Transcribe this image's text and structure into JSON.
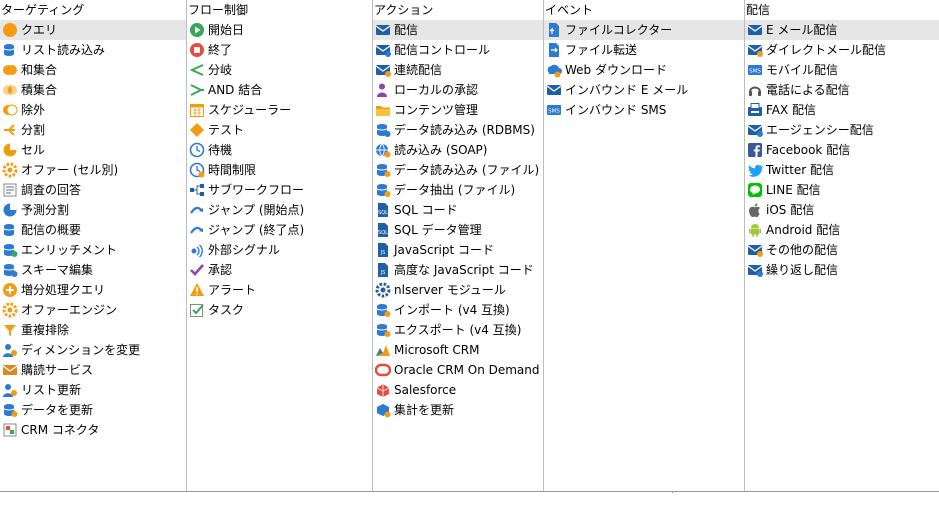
{
  "columns": [
    {
      "header": "ターゲティング",
      "items": [
        {
          "label": "クエリ",
          "icon": "query-icon",
          "selected": true
        },
        {
          "label": "リスト読み込み",
          "icon": "list-read-icon"
        },
        {
          "label": "和集合",
          "icon": "union-icon"
        },
        {
          "label": "積集合",
          "icon": "intersection-icon"
        },
        {
          "label": "除外",
          "icon": "exclusion-icon"
        },
        {
          "label": "分割",
          "icon": "split-icon"
        },
        {
          "label": "セル",
          "icon": "cell-icon"
        },
        {
          "label": "オファー (セル別)",
          "icon": "offer-by-cell-icon"
        },
        {
          "label": "調査の回答",
          "icon": "survey-answer-icon"
        },
        {
          "label": "予測分割",
          "icon": "predictive-split-icon"
        },
        {
          "label": "配信の概要",
          "icon": "delivery-outline-icon"
        },
        {
          "label": "エンリッチメント",
          "icon": "enrichment-icon"
        },
        {
          "label": "スキーマ編集",
          "icon": "schema-edit-icon"
        },
        {
          "label": "増分処理クエリ",
          "icon": "incremental-query-icon"
        },
        {
          "label": "オファーエンジン",
          "icon": "offer-engine-icon"
        },
        {
          "label": "重複排除",
          "icon": "deduplication-icon"
        },
        {
          "label": "ディメンションを変更",
          "icon": "change-dimension-icon"
        },
        {
          "label": "購読サービス",
          "icon": "subscription-services-icon"
        },
        {
          "label": "リスト更新",
          "icon": "list-update-icon"
        },
        {
          "label": "データを更新",
          "icon": "update-data-icon"
        },
        {
          "label": "CRM コネクタ",
          "icon": "crm-connector-icon"
        }
      ]
    },
    {
      "header": "フロー制御",
      "items": [
        {
          "label": "開始日",
          "icon": "start-icon"
        },
        {
          "label": "終了",
          "icon": "end-icon"
        },
        {
          "label": "分岐",
          "icon": "fork-icon"
        },
        {
          "label": "AND 結合",
          "icon": "and-join-icon"
        },
        {
          "label": "スケジューラー",
          "icon": "scheduler-icon"
        },
        {
          "label": "テスト",
          "icon": "test-icon"
        },
        {
          "label": "待機",
          "icon": "wait-icon"
        },
        {
          "label": "時間制限",
          "icon": "time-limit-icon"
        },
        {
          "label": "サブワークフロー",
          "icon": "sub-workflow-icon"
        },
        {
          "label": "ジャンプ (開始点)",
          "icon": "jump-start-icon"
        },
        {
          "label": "ジャンプ (終了点)",
          "icon": "jump-end-icon"
        },
        {
          "label": "外部シグナル",
          "icon": "external-signal-icon"
        },
        {
          "label": "承認",
          "icon": "approval-icon"
        },
        {
          "label": "アラート",
          "icon": "alert-icon"
        },
        {
          "label": "タスク",
          "icon": "task-icon"
        }
      ]
    },
    {
      "header": "アクション",
      "items": [
        {
          "label": "配信",
          "icon": "delivery-icon",
          "selected": true
        },
        {
          "label": "配信コントロール",
          "icon": "delivery-control-icon"
        },
        {
          "label": "連続配信",
          "icon": "continuous-delivery-icon"
        },
        {
          "label": "ローカルの承認",
          "icon": "local-approval-icon"
        },
        {
          "label": "コンテンツ管理",
          "icon": "content-management-icon"
        },
        {
          "label": "データ読み込み (RDBMS)",
          "icon": "data-loading-rdbms-icon"
        },
        {
          "label": "読み込み (SOAP)",
          "icon": "soap-loading-icon"
        },
        {
          "label": "データ読み込み (ファイル)",
          "icon": "data-loading-file-icon"
        },
        {
          "label": "データ抽出 (ファイル)",
          "icon": "data-extraction-file-icon"
        },
        {
          "label": "SQL コード",
          "icon": "sql-code-icon"
        },
        {
          "label": "SQL データ管理",
          "icon": "sql-data-management-icon"
        },
        {
          "label": "JavaScript コード",
          "icon": "javascript-code-icon"
        },
        {
          "label": "高度な JavaScript コード",
          "icon": "advanced-javascript-icon"
        },
        {
          "label": "nlserver モジュール",
          "icon": "nlserver-module-icon"
        },
        {
          "label": "インポート (v4 互換)",
          "icon": "import-v4-icon"
        },
        {
          "label": "エクスポート (v4 互換)",
          "icon": "export-v4-icon"
        },
        {
          "label": "Microsoft CRM",
          "icon": "microsoft-crm-icon"
        },
        {
          "label": "Oracle CRM On Demand",
          "icon": "oracle-crm-icon"
        },
        {
          "label": "Salesforce",
          "icon": "salesforce-icon"
        },
        {
          "label": "集計を更新",
          "icon": "update-aggregate-icon"
        }
      ]
    },
    {
      "header": "イベント",
      "items": [
        {
          "label": "ファイルコレクター",
          "icon": "file-collector-icon",
          "selected": true
        },
        {
          "label": "ファイル転送",
          "icon": "file-transfer-icon"
        },
        {
          "label": "Web ダウンロード",
          "icon": "web-download-icon"
        },
        {
          "label": "インバウンド E メール",
          "icon": "inbound-email-icon"
        },
        {
          "label": "インバウンド SMS",
          "icon": "inbound-sms-icon"
        }
      ]
    },
    {
      "header": "配信",
      "items": [
        {
          "label": "E メール配信",
          "icon": "email-delivery-icon",
          "selected": true
        },
        {
          "label": "ダイレクトメール配信",
          "icon": "direct-mail-icon"
        },
        {
          "label": "モバイル配信",
          "icon": "mobile-sms-icon"
        },
        {
          "label": "電話による配信",
          "icon": "phone-delivery-icon"
        },
        {
          "label": "FAX 配信",
          "icon": "fax-delivery-icon"
        },
        {
          "label": "エージェンシー配信",
          "icon": "agency-delivery-icon"
        },
        {
          "label": "Facebook 配信",
          "icon": "facebook-icon"
        },
        {
          "label": "Twitter 配信",
          "icon": "twitter-icon"
        },
        {
          "label": "LINE 配信",
          "icon": "line-icon"
        },
        {
          "label": "iOS 配信",
          "icon": "apple-icon"
        },
        {
          "label": "Android 配信",
          "icon": "android-icon"
        },
        {
          "label": "その他の配信",
          "icon": "other-delivery-icon"
        },
        {
          "label": "繰り返し配信",
          "icon": "recurring-delivery-icon"
        }
      ]
    }
  ]
}
